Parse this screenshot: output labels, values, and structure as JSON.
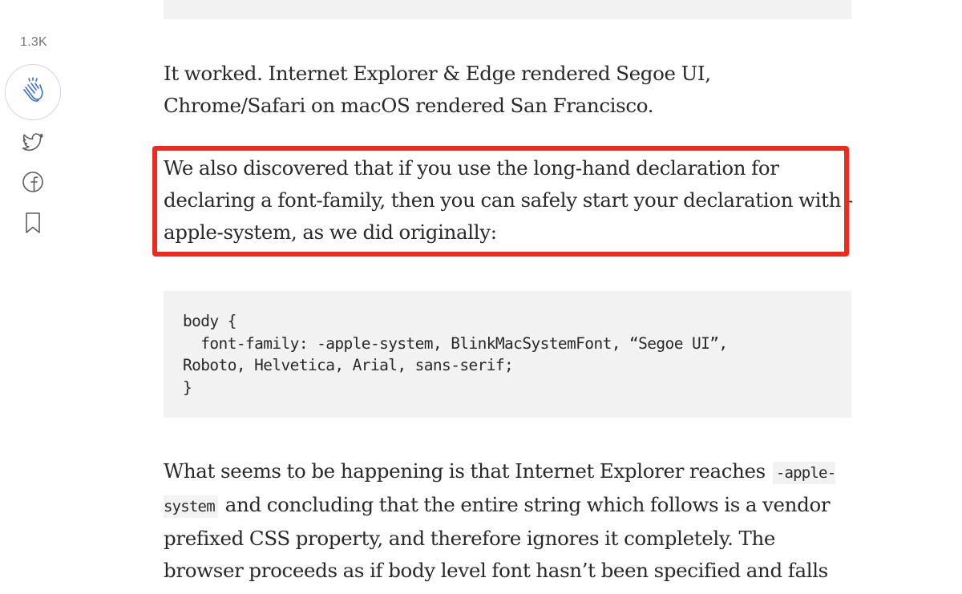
{
  "sidebar": {
    "clap_count": "1.3K",
    "icons": {
      "clap": "clap-icon",
      "twitter": "twitter-icon",
      "facebook": "facebook-icon",
      "bookmark": "bookmark-icon"
    }
  },
  "article": {
    "para1": "It worked. Internet Explorer & Edge rendered Segoe UI, Chrome/Safari on macOS rendered San Francisco.",
    "para2": "We also discovered that if you use the long-hand declaration for declaring a font-family, then you can safely start your declaration with -apple-system, as we did originally:",
    "code_lines": [
      "body {",
      "  font-family: -apple-system, BlinkMacSystemFont, “Segoe UI”,",
      "Roboto, Helvetica, Arial, sans-serif;",
      "}"
    ],
    "para3_before": "What seems to be happening is that Internet Explorer reaches",
    "para3_code": "-apple-system",
    "para3_after": "and concluding that the entire string which follows is a vendor prefixed CSS property, and therefore ignores it completely. The browser proceeds as if body level font hasn’t been specified and falls back to the default font, which in this"
  },
  "colors": {
    "highlight": "#ee2a1c",
    "text": "#292929",
    "muted": "#757575",
    "code_bg": "#f2f2f2"
  }
}
